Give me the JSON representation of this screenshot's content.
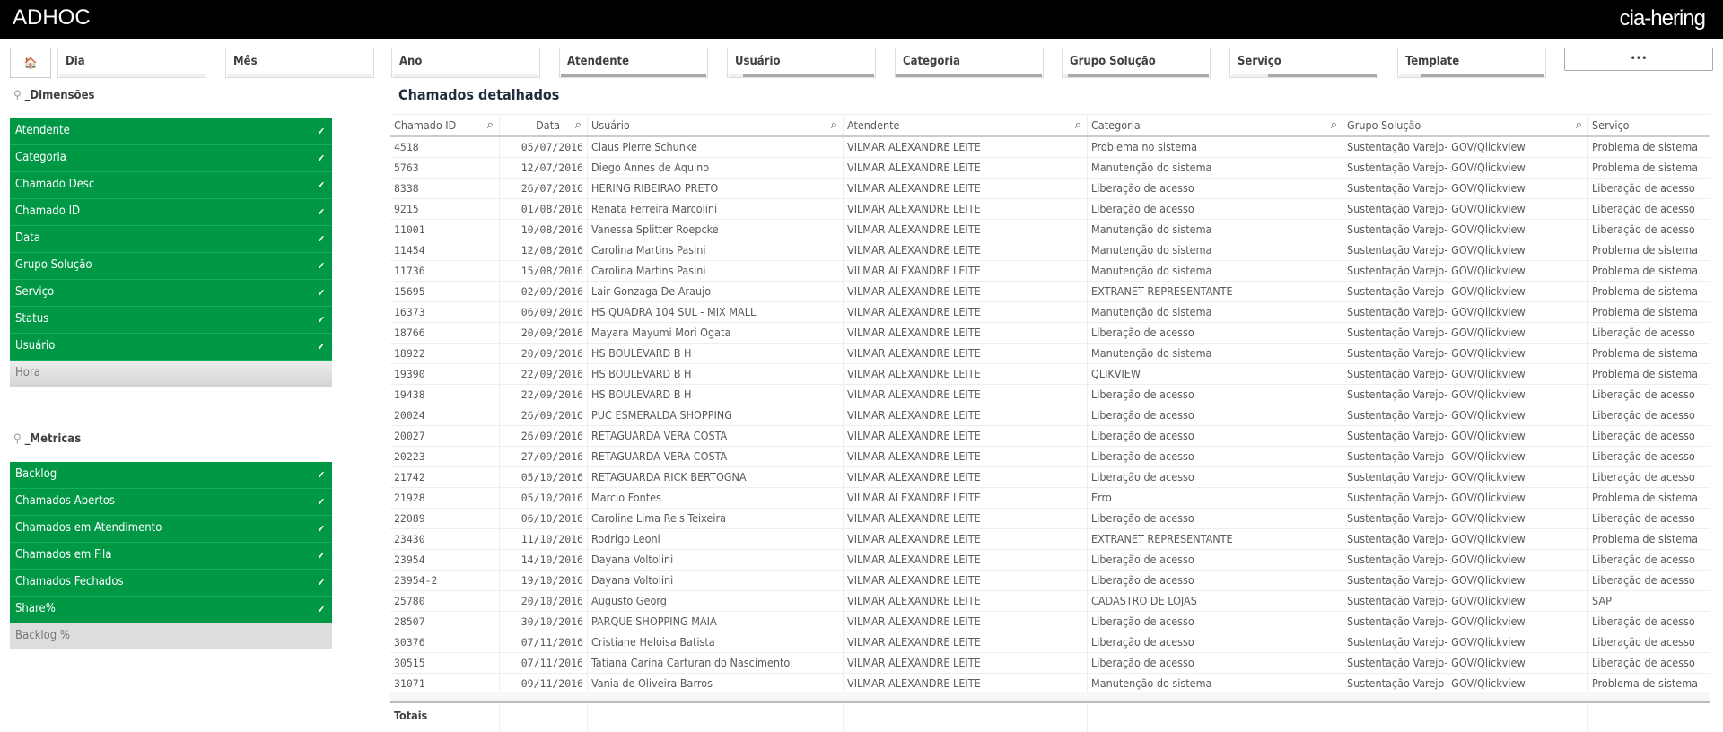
{
  "header": {
    "title": "ADHOC",
    "logo": "cia-hering"
  },
  "filters": {
    "home_icon": "home-icon",
    "items": [
      {
        "label": "Dia",
        "selected_fraction": 0
      },
      {
        "label": "Mês",
        "selected_fraction": 0
      },
      {
        "label": "Ano",
        "selected_fraction": 0
      },
      {
        "label": "Atendente",
        "selected_fraction": 1.0
      },
      {
        "label": "Usuário",
        "selected_fraction": 0.9
      },
      {
        "label": "Categoria",
        "selected_fraction": 1.0
      },
      {
        "label": "Grupo Solução",
        "selected_fraction": 0.97
      },
      {
        "label": "Serviço",
        "selected_fraction": 0.75
      },
      {
        "label": "Template",
        "selected_fraction": 0.85
      }
    ],
    "more_label": "•••"
  },
  "dimensions": {
    "title": "_Dimensões",
    "selected": [
      "Atendente",
      "Categoria",
      "Chamado Desc",
      "Chamado ID",
      "Data",
      "Grupo Solução",
      "Serviço",
      "Status",
      "Usuário"
    ],
    "unselected": [
      "Hora"
    ]
  },
  "metrics": {
    "title": "_Metricas",
    "selected": [
      "Backlog",
      "Chamados Abertos",
      "Chamados em Atendimento",
      "Chamados em Fila",
      "Chamados Fechados",
      "Share%"
    ],
    "unselected": [
      "Backlog %"
    ]
  },
  "colors": {
    "selected": "#009845",
    "alternative": "#dddddd",
    "header": "#000000"
  },
  "table": {
    "title": "Chamados detalhados",
    "columns": [
      "Chamado ID",
      "Data",
      "Usuário",
      "Atendente",
      "Categoria",
      "Grupo Solução",
      "Serviço"
    ],
    "sort_column": "Chamado ID",
    "totals_label": "Totais",
    "rows": [
      [
        "4518",
        "05/07/2016",
        "Claus Pierre Schunke",
        "VILMAR ALEXANDRE LEITE",
        "Problema no sistema",
        "Sustentação Varejo- GOV/Qlickview",
        "Problema de sistema"
      ],
      [
        "5763",
        "12/07/2016",
        "Diego Annes de Aquino",
        "VILMAR ALEXANDRE LEITE",
        "Manutenção do sistema",
        "Sustentação Varejo- GOV/Qlickview",
        "Problema de sistema"
      ],
      [
        "8338",
        "26/07/2016",
        "HERING RIBEIRAO PRETO",
        "VILMAR ALEXANDRE LEITE",
        "Liberação de acesso",
        "Sustentação Varejo- GOV/Qlickview",
        "Liberação de acesso"
      ],
      [
        "9215",
        "01/08/2016",
        "Renata Ferreira Marcolini",
        "VILMAR ALEXANDRE LEITE",
        "Liberação de acesso",
        "Sustentação Varejo- GOV/Qlickview",
        "Liberação de acesso"
      ],
      [
        "11001",
        "10/08/2016",
        "Vanessa Splitter Roepcke",
        "VILMAR ALEXANDRE LEITE",
        "Manutenção do sistema",
        "Sustentação Varejo- GOV/Qlickview",
        "Liberação de acesso"
      ],
      [
        "11454",
        "12/08/2016",
        "Carolina Martins Pasini",
        "VILMAR ALEXANDRE LEITE",
        "Manutenção do sistema",
        "Sustentação Varejo- GOV/Qlickview",
        "Problema de sistema"
      ],
      [
        "11736",
        "15/08/2016",
        "Carolina Martins Pasini",
        "VILMAR ALEXANDRE LEITE",
        "Manutenção do sistema",
        "Sustentação Varejo- GOV/Qlickview",
        "Problema de sistema"
      ],
      [
        "15695",
        "02/09/2016",
        "Lair Gonzaga De Araujo",
        "VILMAR ALEXANDRE LEITE",
        "EXTRANET REPRESENTANTE",
        "Sustentação Varejo- GOV/Qlickview",
        "Problema de sistema"
      ],
      [
        "16373",
        "06/09/2016",
        "HS QUADRA 104 SUL - MIX MALL",
        "VILMAR ALEXANDRE LEITE",
        "Manutenção do sistema",
        "Sustentação Varejo- GOV/Qlickview",
        "Problema de sistema"
      ],
      [
        "18766",
        "20/09/2016",
        "Mayara Mayumi Mori Ogata",
        "VILMAR ALEXANDRE LEITE",
        "Liberação de acesso",
        "Sustentação Varejo- GOV/Qlickview",
        "Liberação de acesso"
      ],
      [
        "18922",
        "20/09/2016",
        "HS BOULEVARD B H",
        "VILMAR ALEXANDRE LEITE",
        "Manutenção do sistema",
        "Sustentação Varejo- GOV/Qlickview",
        "Problema de sistema"
      ],
      [
        "19390",
        "22/09/2016",
        "HS BOULEVARD B H",
        "VILMAR ALEXANDRE LEITE",
        "QLIKVIEW",
        "Sustentação Varejo- GOV/Qlickview",
        "Problema de sistema"
      ],
      [
        "19438",
        "22/09/2016",
        "HS BOULEVARD B H",
        "VILMAR ALEXANDRE LEITE",
        "Liberação de acesso",
        "Sustentação Varejo- GOV/Qlickview",
        "Liberação de acesso"
      ],
      [
        "20024",
        "26/09/2016",
        "PUC ESMERALDA SHOPPING",
        "VILMAR ALEXANDRE LEITE",
        "Liberação de acesso",
        "Sustentação Varejo- GOV/Qlickview",
        "Liberação de acesso"
      ],
      [
        "20027",
        "26/09/2016",
        "RETAGUARDA VERA COSTA",
        "VILMAR ALEXANDRE LEITE",
        "Liberação de acesso",
        "Sustentação Varejo- GOV/Qlickview",
        "Liberação de acesso"
      ],
      [
        "20223",
        "27/09/2016",
        "RETAGUARDA VERA COSTA",
        "VILMAR ALEXANDRE LEITE",
        "Liberação de acesso",
        "Sustentação Varejo- GOV/Qlickview",
        "Liberação de acesso"
      ],
      [
        "21742",
        "05/10/2016",
        "RETAGUARDA RICK BERTOGNA",
        "VILMAR ALEXANDRE LEITE",
        "Liberação de acesso",
        "Sustentação Varejo- GOV/Qlickview",
        "Liberação de acesso"
      ],
      [
        "21928",
        "05/10/2016",
        "Marcio Fontes",
        "VILMAR ALEXANDRE LEITE",
        "Erro",
        "Sustentação Varejo- GOV/Qlickview",
        "Problema de sistema"
      ],
      [
        "22089",
        "06/10/2016",
        "Caroline Lima Reis Teixeira",
        "VILMAR ALEXANDRE LEITE",
        "Liberação de acesso",
        "Sustentação Varejo- GOV/Qlickview",
        "Liberação de acesso"
      ],
      [
        "23430",
        "11/10/2016",
        "Rodrigo Leoni",
        "VILMAR ALEXANDRE LEITE",
        "EXTRANET REPRESENTANTE",
        "Sustentação Varejo- GOV/Qlickview",
        "Problema de sistema"
      ],
      [
        "23954",
        "14/10/2016",
        "Dayana Voltolini",
        "VILMAR ALEXANDRE LEITE",
        "Liberação de acesso",
        "Sustentação Varejo- GOV/Qlickview",
        "Liberação de acesso"
      ],
      [
        "23954-2",
        "19/10/2016",
        "Dayana Voltolini",
        "VILMAR ALEXANDRE LEITE",
        "Liberação de acesso",
        "Sustentação Varejo- GOV/Qlickview",
        "Liberação de acesso"
      ],
      [
        "25780",
        "20/10/2016",
        "Augusto Georg",
        "VILMAR ALEXANDRE LEITE",
        "CADASTRO DE LOJAS",
        "Sustentação Varejo- GOV/Qlickview",
        "SAP"
      ],
      [
        "28507",
        "30/10/2016",
        "PARQUE SHOPPING MAIA",
        "VILMAR ALEXANDRE LEITE",
        "Liberação de acesso",
        "Sustentação Varejo- GOV/Qlickview",
        "Liberação de acesso"
      ],
      [
        "30376",
        "07/11/2016",
        "Cristiane Heloisa Batista",
        "VILMAR ALEXANDRE LEITE",
        "Liberação de acesso",
        "Sustentação Varejo- GOV/Qlickview",
        "Liberação de acesso"
      ],
      [
        "30515",
        "07/11/2016",
        "Tatiana Carina Carturan do Nascimento",
        "VILMAR ALEXANDRE LEITE",
        "Liberação de acesso",
        "Sustentação Varejo- GOV/Qlickview",
        "Liberação de acesso"
      ],
      [
        "31071",
        "09/11/2016",
        "Vania de Oliveira Barros",
        "VILMAR ALEXANDRE LEITE",
        "Manutenção do sistema",
        "Sustentação Varejo- GOV/Qlickview",
        "Problema de sistema"
      ]
    ]
  }
}
